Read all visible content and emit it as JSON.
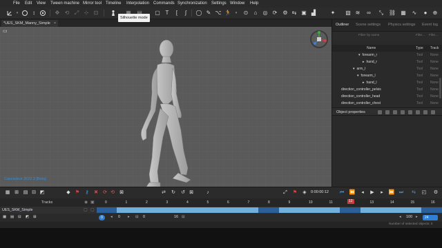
{
  "menu": [
    "File",
    "Edit",
    "View",
    "Tween machine",
    "Mirror tool",
    "Timeline",
    "Interpolation",
    "Commands",
    "Synchronization",
    "Settings",
    "Window",
    "Help"
  ],
  "tooltip": "Silhouette mode",
  "document_tab": {
    "title": "*UES_SKM_Manny_Simple",
    "close": "×"
  },
  "viewport": {
    "watermark": "Cascadeur 2022.3 [Beta]"
  },
  "right_tabs": [
    "Outliner",
    "Scene settings",
    "Physics settings",
    "Event log"
  ],
  "filters": {
    "name": "Filter by name",
    "type": "Filte...",
    "track": "Filte..."
  },
  "outliner_headers": {
    "name": "Name",
    "type": "Type",
    "track": "Track"
  },
  "outliner_rows": [
    {
      "name": "forearm_r",
      "arrow": "▾",
      "type": "Tool",
      "track": "None"
    },
    {
      "name": "hand_r",
      "arrow": "▸",
      "type": "Tool",
      "track": "None"
    },
    {
      "name": "arm_l",
      "arrow": "▾",
      "type": "Tool",
      "track": "None"
    },
    {
      "name": "forearm_l",
      "arrow": "▾",
      "type": "Tool",
      "track": "None"
    },
    {
      "name": "hand_l",
      "arrow": "▸",
      "type": "Tool",
      "track": "None"
    },
    {
      "name": "direction_controller_pelvis",
      "arrow": "",
      "type": "Tool",
      "track": "None"
    },
    {
      "name": "direction_controller_head",
      "arrow": "",
      "type": "Tool",
      "track": "None"
    },
    {
      "name": "direction_controller_chest",
      "arrow": "",
      "type": "Tool",
      "track": "None"
    }
  ],
  "object_properties": "Object properties",
  "transport": {
    "time": "0:00:00:12"
  },
  "tracks_label": "Tracks",
  "timeline_ticks": [
    "0",
    "1",
    "2",
    "3",
    "4",
    "5",
    "6",
    "7",
    "8",
    "9",
    "10",
    "11",
    "12",
    "13",
    "14",
    "15",
    "16"
  ],
  "current_frame": "12",
  "track_name": "UES_SKM_Simple",
  "bottom": {
    "start": "0",
    "range_start": "0",
    "range_end": "16",
    "total": "100",
    "fps_badge": "24"
  },
  "status": "Number of selected objects: 0",
  "colors": {
    "accent": "#2e7fd6",
    "keyframe_block": "#2a5f9a",
    "interval": "#6fb0dd",
    "playhead": "#d23b3b"
  }
}
